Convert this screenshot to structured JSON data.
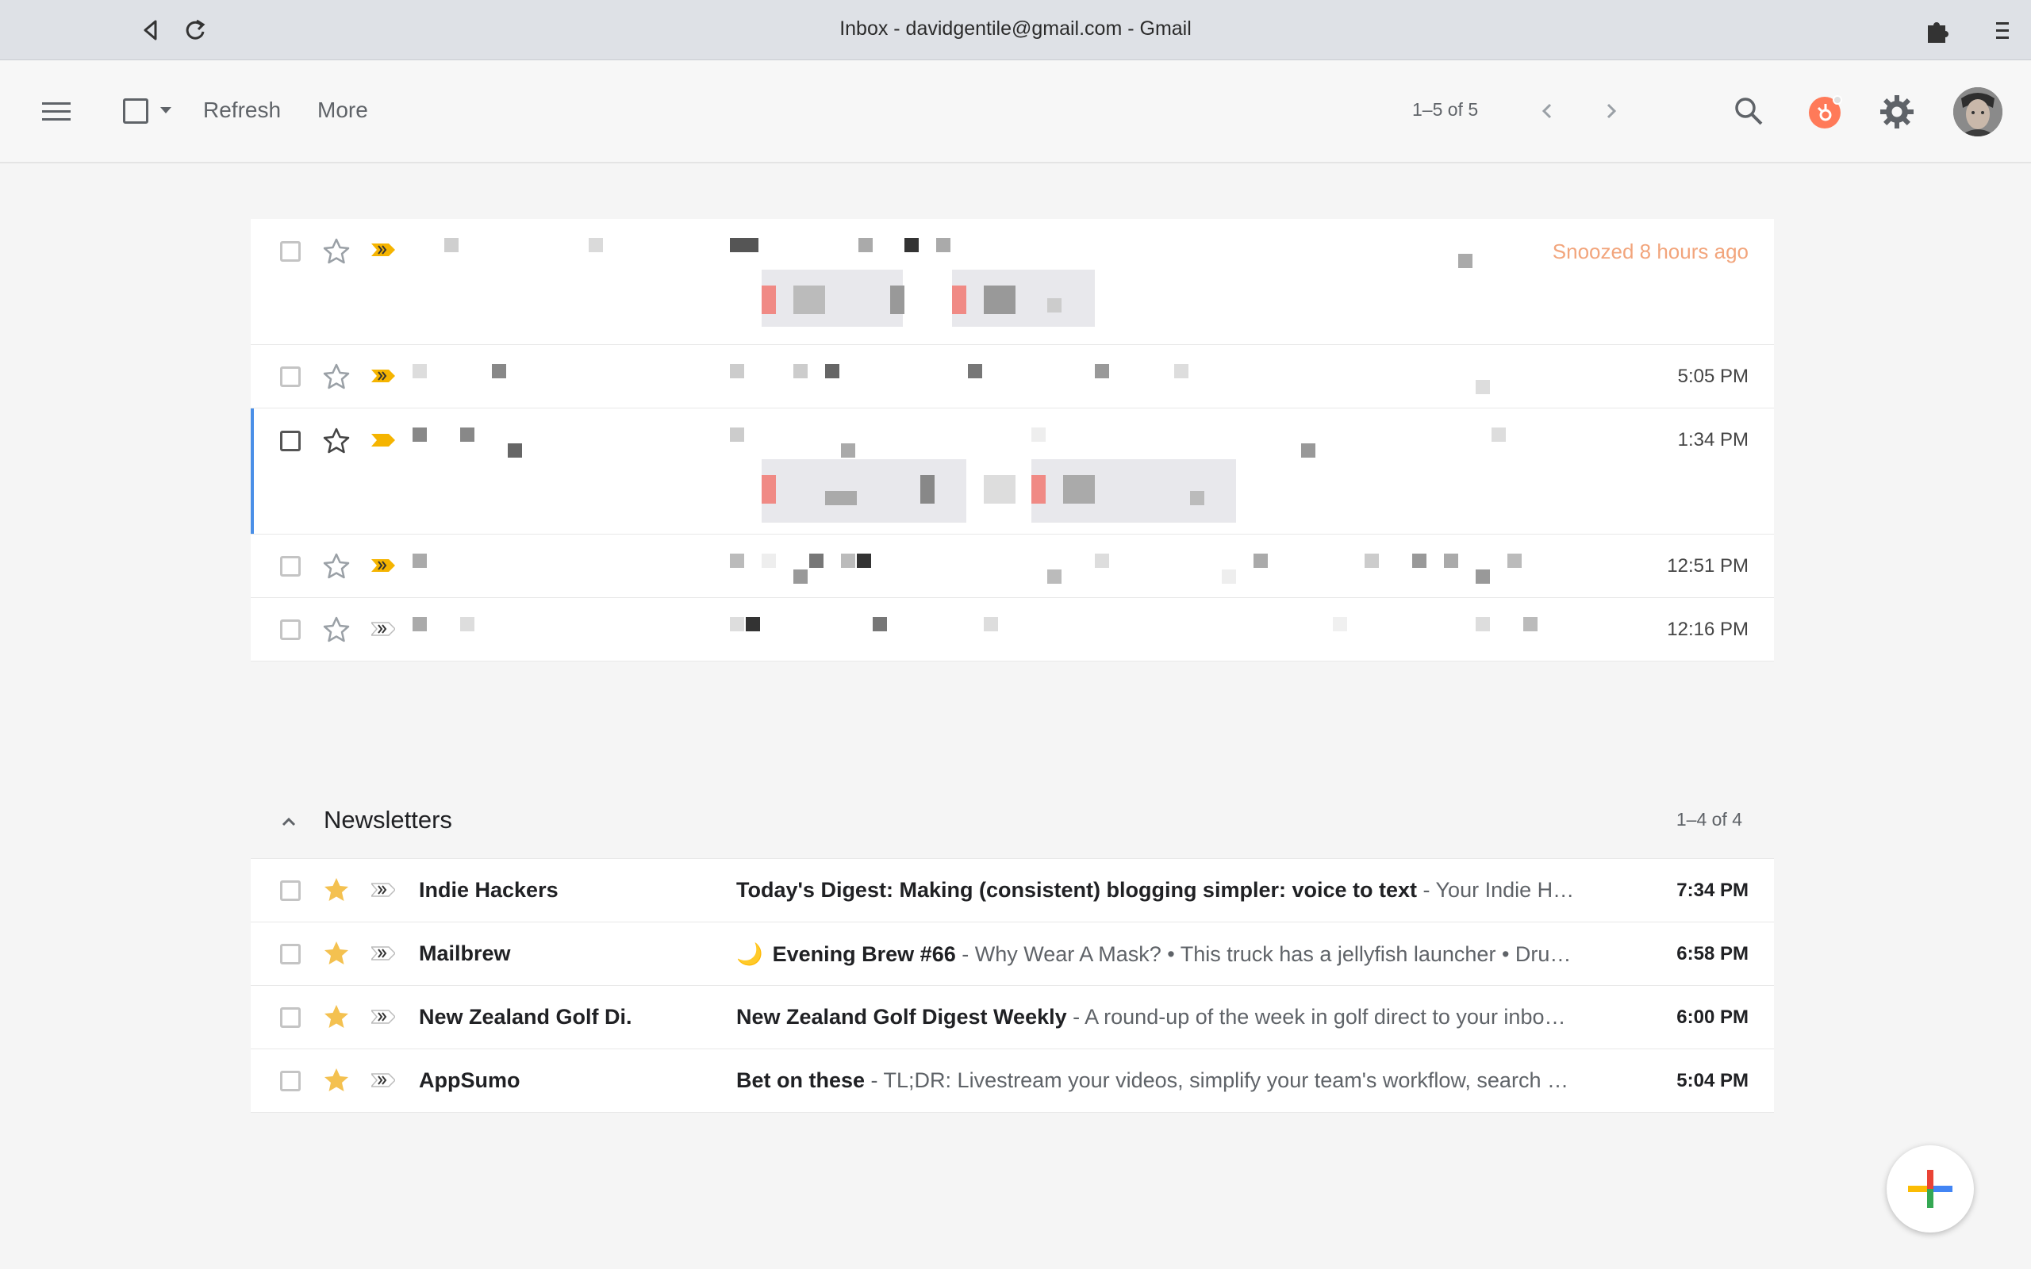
{
  "window": {
    "title": "Inbox - davidgentile@gmail.com - Gmail"
  },
  "toolbar": {
    "refresh_label": "Refresh",
    "more_label": "More",
    "pagination": "1–5 of 5"
  },
  "inbox": {
    "rows": [
      {
        "time": "Snoozed 8 hours ago"
      },
      {
        "time": "5:05 PM"
      },
      {
        "time": "1:34 PM"
      },
      {
        "time": "12:51 PM"
      },
      {
        "time": "12:16 PM"
      }
    ]
  },
  "newsletters": {
    "title": "Newsletters",
    "count": "1–4 of 4",
    "rows": [
      {
        "sender": "Indie Hackers",
        "emoji": "",
        "subject": "Today's Digest: Making (consistent) blogging simpler: voice to text",
        "snippet": " - Your Indie Ha…",
        "time": "7:34 PM"
      },
      {
        "sender": "Mailbrew",
        "emoji": "🌙",
        "subject": "Evening Brew #66",
        "snippet": " - Why Wear A Mask? • This truck has a jellyfish launcher • Dru…",
        "time": "6:58 PM"
      },
      {
        "sender": "New Zealand Golf Di.",
        "emoji": "",
        "subject": "New Zealand Golf Digest Weekly",
        "snippet": " - A round-up of the week in golf direct to your inbo…",
        "time": "6:00 PM"
      },
      {
        "sender": "AppSumo",
        "emoji": "",
        "subject": "Bet on these",
        "snippet": " - TL;DR: Livestream your videos, simplify your team's workflow, search …",
        "time": "5:04 PM"
      }
    ]
  },
  "colors": {
    "star_filled": "#f4c150",
    "importance_marker": "#f5b400",
    "snoozed_text": "#f2a57c",
    "selected_row_bar": "#4a8fe7",
    "hubspot_orange": "#ff7a59"
  }
}
